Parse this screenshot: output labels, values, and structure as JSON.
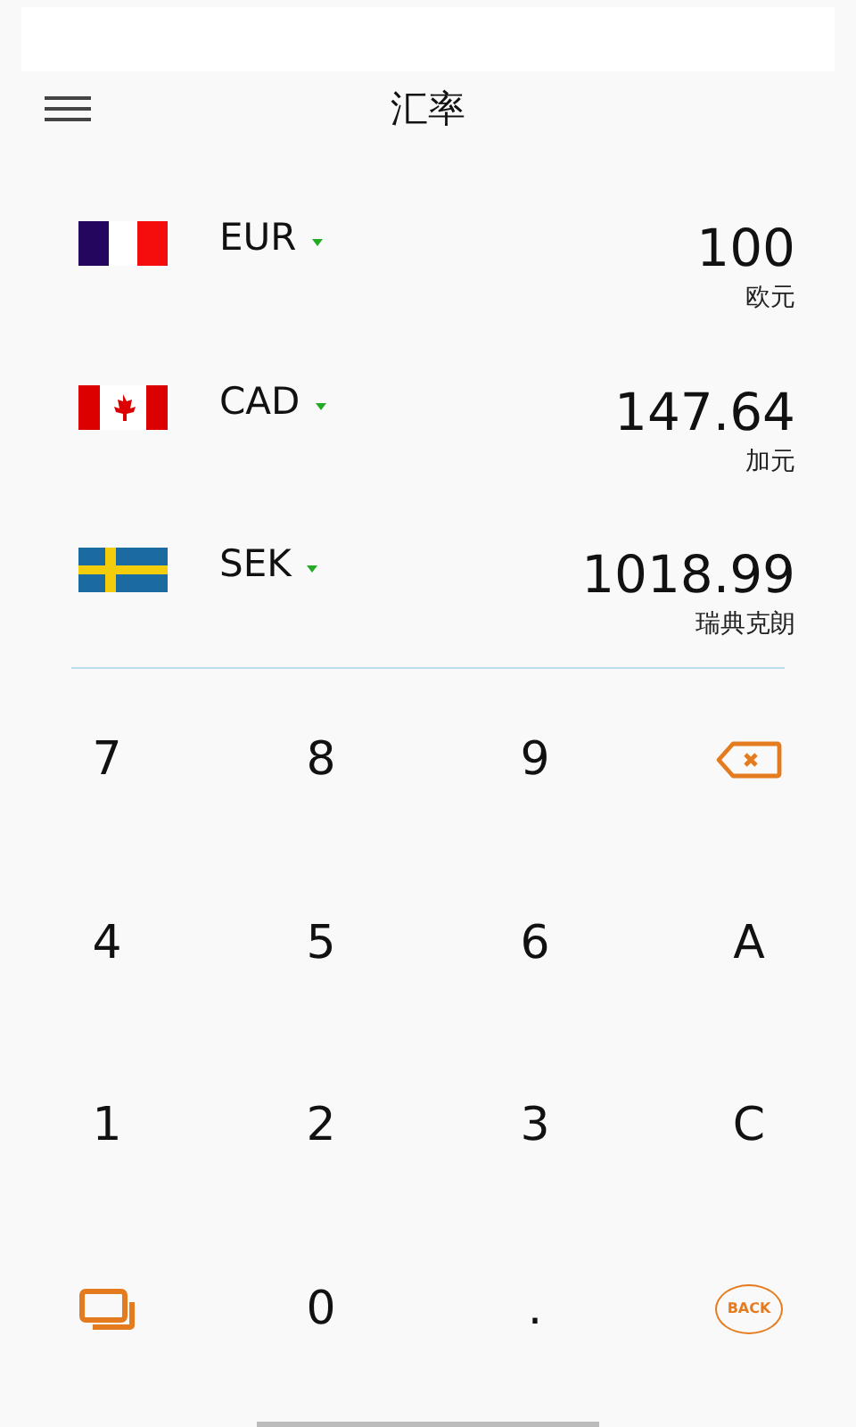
{
  "header": {
    "title": "汇率"
  },
  "currencies": [
    {
      "code": "EUR",
      "kind": "france",
      "amount": "100",
      "name": "欧元"
    },
    {
      "code": "CAD",
      "kind": "canada",
      "amount": "147.64",
      "name": "加元"
    },
    {
      "code": "SEK",
      "kind": "sweden",
      "amount": "1018.99",
      "name": "瑞典克朗"
    }
  ],
  "keypad": [
    {
      "kind": "text",
      "label": "7"
    },
    {
      "kind": "text",
      "label": "8"
    },
    {
      "kind": "text",
      "label": "9"
    },
    {
      "kind": "backspace"
    },
    {
      "kind": "text",
      "label": "4"
    },
    {
      "kind": "text",
      "label": "5"
    },
    {
      "kind": "text",
      "label": "6"
    },
    {
      "kind": "text",
      "label": "A"
    },
    {
      "kind": "text",
      "label": "1"
    },
    {
      "kind": "text",
      "label": "2"
    },
    {
      "kind": "text",
      "label": "3"
    },
    {
      "kind": "text",
      "label": "C"
    },
    {
      "kind": "copy"
    },
    {
      "kind": "text",
      "label": "0"
    },
    {
      "kind": "text",
      "label": "."
    },
    {
      "kind": "back",
      "label": "BACK"
    }
  ]
}
